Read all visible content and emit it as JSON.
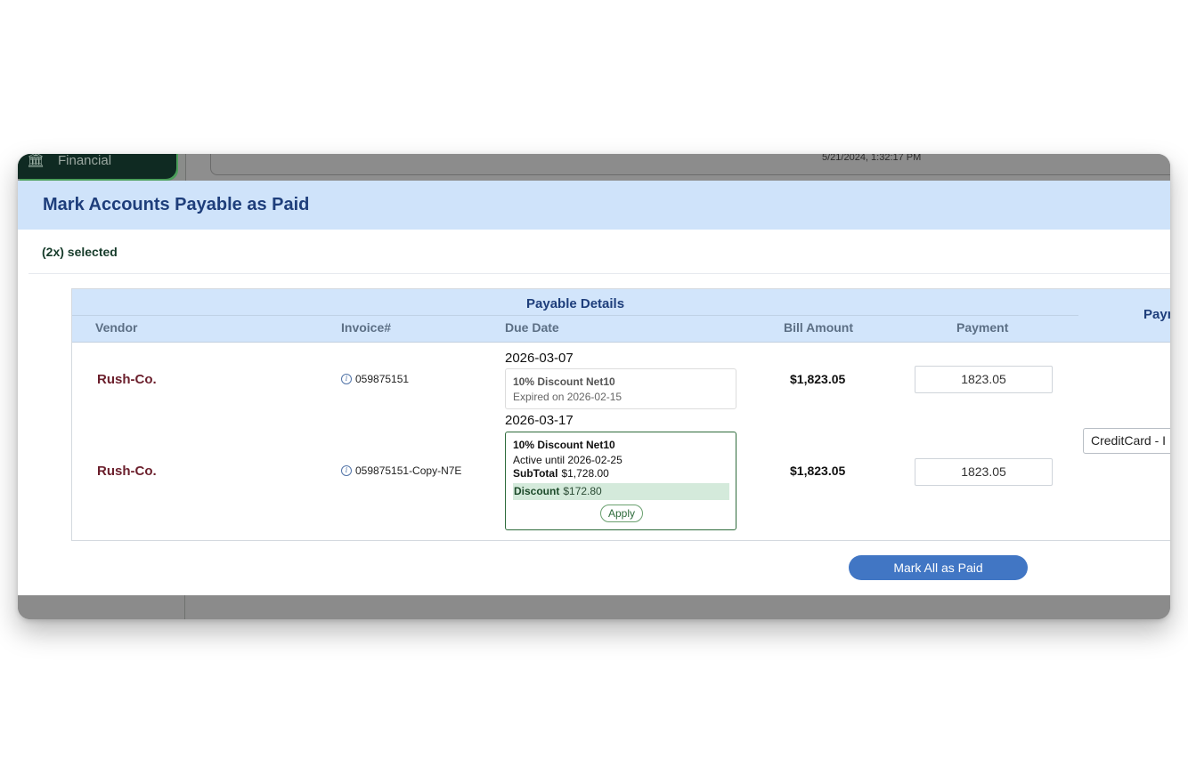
{
  "background": {
    "nav_item_label": "Financial",
    "timestamp": "5/21/2024, 1:32:17 PM"
  },
  "modal": {
    "title": "Mark Accounts Payable as Paid",
    "selected_count": "(2x) selected",
    "table": {
      "group_title": "Payable Details",
      "group_title_right": "Payn",
      "columns": {
        "vendor": "Vendor",
        "invoice": "Invoice#",
        "due_date": "Due Date",
        "bill_amount": "Bill Amount",
        "payment": "Payment"
      },
      "rows": [
        {
          "vendor": "Rush-Co.",
          "invoice": "059875151",
          "due_date": "2026-03-07",
          "discount": {
            "title": "10% Discount Net10",
            "status": "Expired on 2026-02-15"
          },
          "bill_amount": "$1,823.05",
          "payment": "1823.05"
        },
        {
          "vendor": "Rush-Co.",
          "invoice": "059875151-Copy-N7E",
          "due_date": "2026-03-17",
          "discount": {
            "title": "10% Discount Net10",
            "status": "Active until 2026-02-25",
            "subtotal_label": "SubTotal",
            "subtotal_value": "$1,728.00",
            "discount_label": "Discount",
            "discount_value": "$172.80",
            "apply_label": "Apply"
          },
          "bill_amount": "$1,823.05",
          "payment": "1823.05"
        }
      ],
      "payment_method": "CreditCard - I"
    },
    "mark_all_label": "Mark All as Paid"
  },
  "colors": {
    "header_bg": "#cfe3fa",
    "title": "#1e3e7b",
    "vendor": "#6b1f2c",
    "primary_button": "#4176c4",
    "discount_green": "#2e6b3b"
  },
  "icons": [
    "bank-icon",
    "info-icon"
  ]
}
